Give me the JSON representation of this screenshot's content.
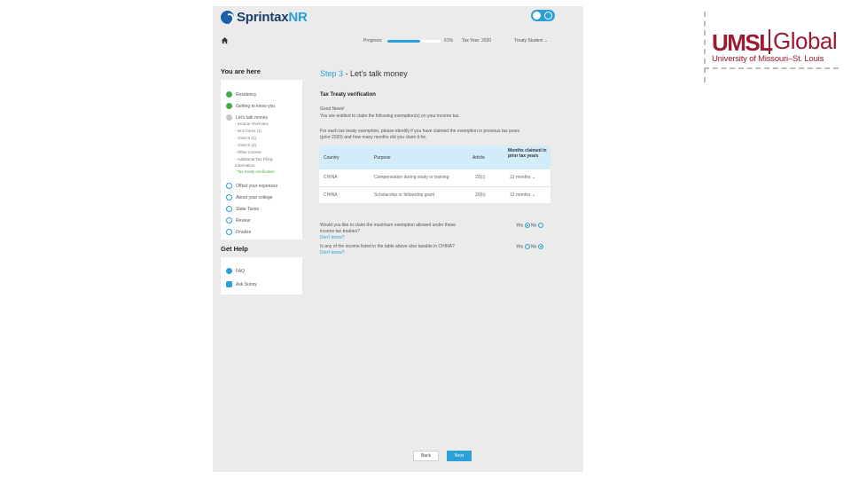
{
  "brand": {
    "name_main": "Sprintax",
    "name_accent": "NR"
  },
  "topbar": {
    "progress_label": "Progress:",
    "progress_value": "61%",
    "progress_fraction": 0.61,
    "tax_year": "Tax Year: 2020",
    "user": "Treaty Student",
    "user_caret": "⌄"
  },
  "sidebar": {
    "title": "You are here",
    "items": [
      {
        "label": "Residency",
        "state": "done"
      },
      {
        "label": "Getting to know you",
        "state": "done"
      },
      {
        "label": "Let's talk money",
        "state": "current"
      },
      {
        "label": "Offset your expenses",
        "state": "todo"
      },
      {
        "label": "About your college",
        "state": "todo"
      },
      {
        "label": "State Taxes",
        "state": "todo"
      },
      {
        "label": "Review",
        "state": "todo"
      },
      {
        "label": "Finalize",
        "state": "todo"
      }
    ],
    "subitems": [
      {
        "label": "- Income Overview"
      },
      {
        "label": "- W-2 forms (1)"
      },
      {
        "label": "- 1042-S (1)"
      },
      {
        "label": "- 1042-S (2)"
      },
      {
        "label": "- Other income"
      },
      {
        "label": "- Additional Tax Filing"
      },
      {
        "label": "  Information"
      },
      {
        "label": "- Tax treaty verification",
        "active": true
      }
    ]
  },
  "help": {
    "title": "Get Help",
    "items": [
      {
        "label": "FAQ",
        "icon": "question-icon"
      },
      {
        "label": "Ask Sunny",
        "icon": "chat-icon"
      }
    ]
  },
  "main": {
    "step_number": "Step 3",
    "step_title": " - Let's talk money",
    "section_title": "Tax Treaty verification",
    "good_news": "Good News!",
    "entitled_text": "You are entitled to claim the following exemption(s) on your income tax.",
    "instruction_line1": "For each tax treaty exemption, please identify if you have claimed the exemption in previous tax years",
    "instruction_line2": "(prior 2020) and how many months did you claim it for.",
    "table": {
      "headers": [
        "Country",
        "Purpose",
        "Article",
        "Months claimed in prior tax years"
      ],
      "rows": [
        [
          "CHINA",
          "Compensation during study or training",
          "20(c)",
          "12 months"
        ],
        [
          "CHINA",
          "Scholarship or fellowship grant",
          "20(b)",
          "12 months"
        ]
      ]
    },
    "question1_line1": "Would you like to claim the maximum exemption allowed under these",
    "question1_line2": "income tax treaties?",
    "question2": "Is any of the income listed in the table above also taxable in CHINA?",
    "dont_know": "Don't know?",
    "yes_label": "Yes",
    "no_label": "No",
    "q1_answer": "Yes",
    "q2_answer": "No"
  },
  "buttons": {
    "back": "Back",
    "next": "Next"
  },
  "university": {
    "short": "UMSL",
    "word": "Global",
    "full": "University of Missouri–St. Louis"
  },
  "colors": {
    "accent": "#2a9fd8",
    "success": "#3fae49",
    "brand_dark": "#1b3e6b",
    "umsl_red": "#9b1b30"
  }
}
